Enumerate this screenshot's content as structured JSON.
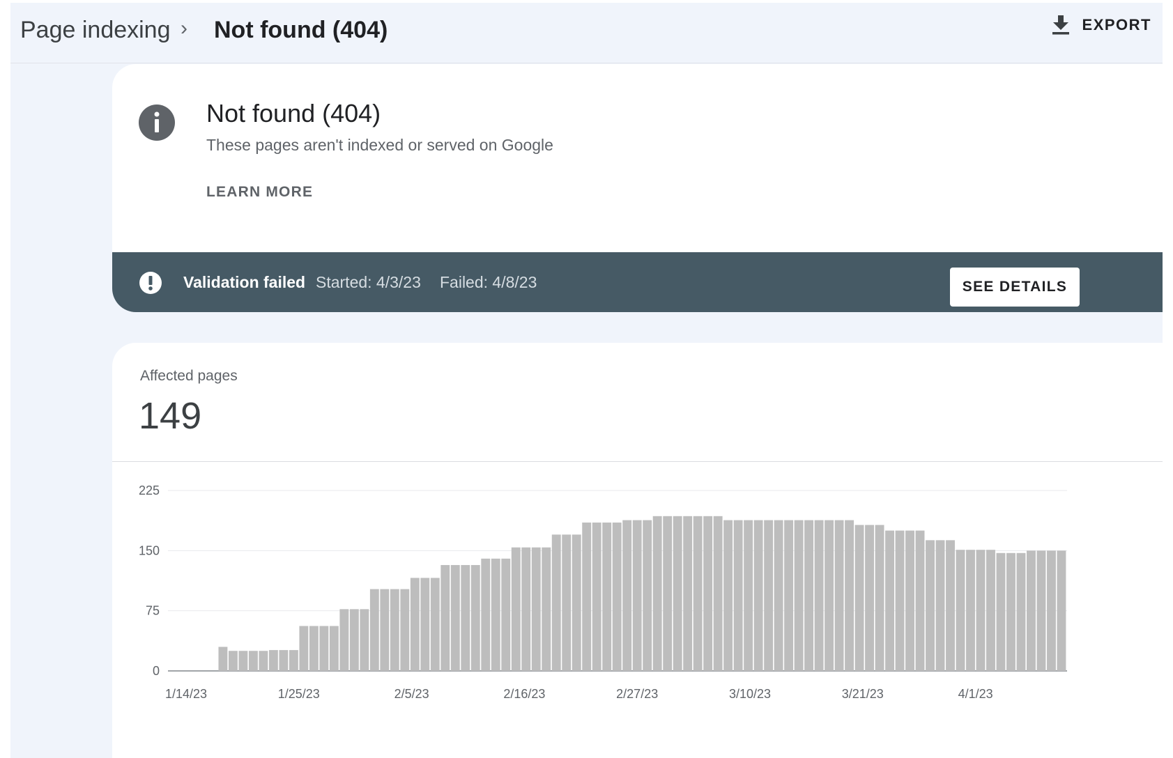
{
  "header": {
    "breadcrumb_root": "Page indexing",
    "breadcrumb_sep": "›",
    "breadcrumb_current": "Not found (404)",
    "export_label": "EXPORT",
    "export_icon": "download-icon"
  },
  "info": {
    "icon": "info-icon",
    "title": "Not found (404)",
    "subtitle": "These pages aren't indexed or served on Google",
    "learn_more": "LEARN MORE"
  },
  "validation": {
    "icon": "exclamation-icon",
    "status": "Validation failed",
    "started": "Started: 4/3/23",
    "failed": "Failed: 4/8/23",
    "button": "SEE DETAILS"
  },
  "summary": {
    "label": "Affected pages",
    "count": "149"
  },
  "colors": {
    "page_background": "#f0f4fb",
    "banner": "#465a65",
    "bar": "#bdbdbd"
  },
  "chart_data": {
    "type": "bar",
    "ylim": [
      0,
      225
    ],
    "y_ticks": [
      "0",
      "75",
      "150",
      "225"
    ],
    "x_tick_labels": [
      "1/14/23",
      "1/25/23",
      "2/5/23",
      "2/16/23",
      "2/27/23",
      "3/10/23",
      "3/21/23",
      "4/1/23"
    ],
    "grid": true,
    "values": [
      0,
      0,
      0,
      0,
      0,
      30,
      25,
      25,
      25,
      25,
      26,
      26,
      26,
      56,
      56,
      56,
      56,
      77,
      77,
      77,
      102,
      102,
      102,
      102,
      116,
      116,
      116,
      132,
      132,
      132,
      132,
      140,
      140,
      140,
      154,
      154,
      154,
      154,
      170,
      170,
      170,
      185,
      185,
      185,
      185,
      188,
      188,
      188,
      193,
      193,
      193,
      193,
      193,
      193,
      193,
      188,
      188,
      188,
      188,
      188,
      188,
      188,
      188,
      188,
      188,
      188,
      188,
      188,
      182,
      182,
      182,
      175,
      175,
      175,
      175,
      163,
      163,
      163,
      151,
      151,
      151,
      151,
      147,
      147,
      147,
      150,
      150,
      150,
      150
    ]
  }
}
